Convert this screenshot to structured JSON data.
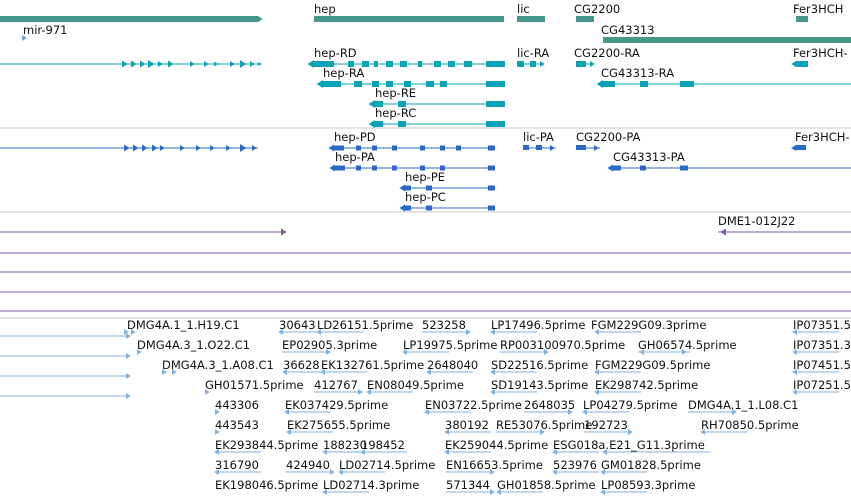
{
  "colors": {
    "gene": "#48978f",
    "transcript": "#0aa3b6",
    "protein": "#2a69c8",
    "clone": "#7a57a8",
    "est": "#7fb2dc",
    "separator": "#c8c8c8"
  },
  "labels": {
    "gene": [
      "mir-971",
      "hep",
      "lic",
      "CG2200",
      "CG43313",
      "Fer3HCH"
    ],
    "transcript": [
      "hep-RD",
      "hep-RA",
      "hep-RE",
      "hep-RC",
      "lic-RA",
      "CG2200-RA",
      "CG43313-RA",
      "Fer3HCH-"
    ],
    "protein": [
      "hep-PD",
      "hep-PA",
      "hep-PE",
      "hep-PC",
      "lic-PA",
      "CG2200-PA",
      "CG43313-PA",
      "Fer3HCH-"
    ],
    "clone": [
      "DME1-012J22"
    ],
    "est": [
      "DMG4A.1_1.H19.C1",
      "30643",
      "LD26151.5prime",
      "523258",
      "LP17496.5prime",
      "FGM229G09.3prime",
      "IP07351.5",
      "DMG4A.3_1.O22.C1",
      "EP02905.3prime",
      "LP19975.5prime",
      "RP003100970.5prime",
      "GH06574.5prime",
      "IP07351.3",
      "DMG4A.3_1.A08.C1",
      "36628",
      "EK132761.5prime",
      "2648040",
      "SD22516.5prime",
      "FGM229G09.5prime",
      "IP07451.5",
      "GH01571.5prime",
      "412767",
      "EN08049.5prime",
      "SD19143.5prime",
      "EK298742.5prime",
      "IP07251.5",
      "443306",
      "EK037429.5prime",
      "EN03722.5prime",
      "2648035",
      "LP04279.5prime",
      "DMG4A.1_1.L08.C1",
      "443543",
      "EK275655.5prime",
      "380192",
      "RE53076.5prime",
      "192723",
      "RH70850.5prime",
      "EK293844.5prime",
      "188230",
      "198452",
      "EK259044.5prime",
      "ESG018a.E21_G11.3prime",
      "316790",
      "424940",
      "LD02714.5prime",
      "EN16653.5prime",
      "523976",
      "GM01828.5prime",
      "EK198046.5prime",
      "LD02714.3prime",
      "571344",
      "GH01858.5prime",
      "LP08593.3prime"
    ]
  }
}
